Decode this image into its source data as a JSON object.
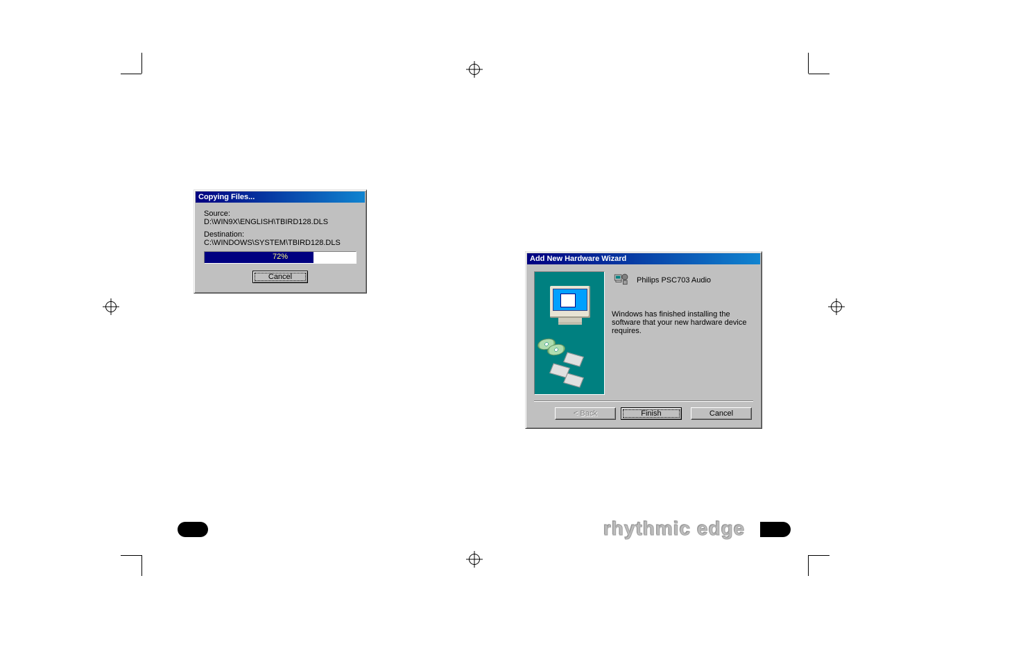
{
  "copy_dialog": {
    "title": "Copying Files...",
    "source_label": "Source:",
    "source_value": "D:\\WIN9X\\ENGLISH\\TBIRD128.DLS",
    "dest_label": "Destination:",
    "dest_value": "C:\\WINDOWS\\SYSTEM\\TBIRD128.DLS",
    "progress_percent": "72%",
    "cancel_label": "Cancel"
  },
  "wizard_dialog": {
    "title": "Add New Hardware Wizard",
    "device_name": "Philips PSC703 Audio",
    "body_text": "Windows has finished installing the software that your new hardware device requires.",
    "back_label": "< Back",
    "finish_label": "Finish",
    "cancel_label": "Cancel"
  },
  "brand_text": "rhythmic edge"
}
